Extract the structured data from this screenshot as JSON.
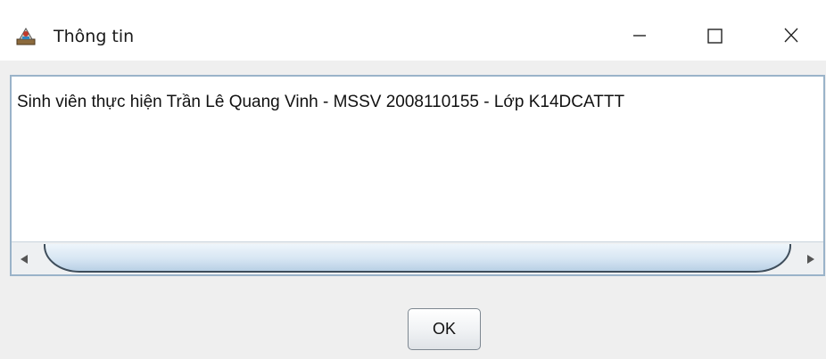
{
  "window": {
    "title": "Thông tin",
    "app_icon": "java-app-icon",
    "controls": {
      "minimize_icon": "minimize-icon",
      "maximize_icon": "maximize-icon",
      "close_icon": "close-icon"
    }
  },
  "message": {
    "text": "Sinh viên thực hiện Trần Lê Quang Vinh - MSSV 2008110155 - Lớp K14DCATTT"
  },
  "scrollbar": {
    "left_arrow_icon": "scroll-left-arrow-icon",
    "right_arrow_icon": "scroll-right-arrow-icon"
  },
  "buttons": {
    "ok_label": "OK"
  },
  "colors": {
    "content_background": "#efefef",
    "pane_border": "#9ab3c9",
    "scroll_thumb": "#d7e6f3"
  }
}
